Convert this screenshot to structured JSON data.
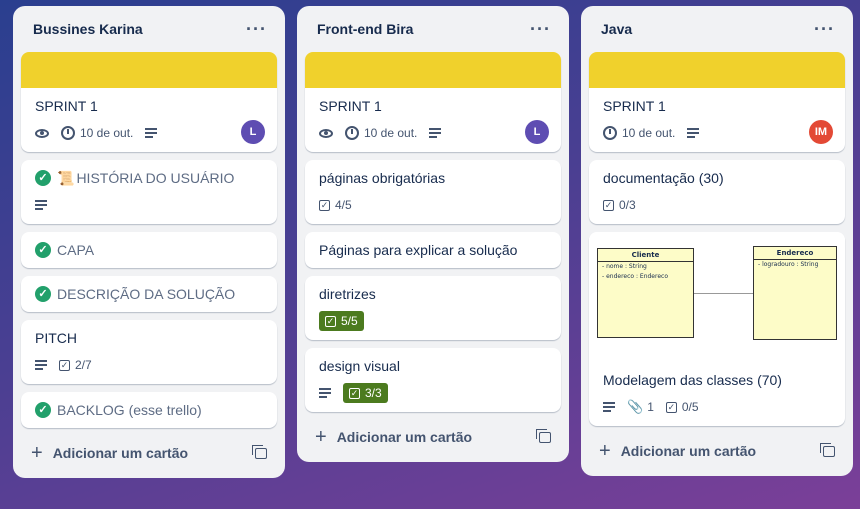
{
  "lists": [
    {
      "title": "Bussines Karina",
      "menu": "···",
      "add_card": "Adicionar um cartão",
      "cards": [
        {
          "title": "SPRINT 1",
          "date": "10 de out.",
          "avatar": "L",
          "avatar_color": "#5e4db2"
        },
        {
          "title": "HISTÓRIA DO USUÁRIO",
          "icon": "scroll-icon"
        },
        {
          "title": "CAPA"
        },
        {
          "title": "DESCRIÇÃO DA SOLUÇÃO"
        },
        {
          "title": "PITCH",
          "checklist": "2/7"
        },
        {
          "title": "BACKLOG (esse trello)"
        }
      ]
    },
    {
      "title": "Front-end Bira",
      "menu": "···",
      "add_card": "Adicionar um cartão",
      "cards": [
        {
          "title": "SPRINT 1",
          "date": "10 de out.",
          "avatar": "L",
          "avatar_color": "#5e4db2"
        },
        {
          "title": "páginas obrigatórias",
          "checklist": "4/5"
        },
        {
          "title": "Páginas para explicar a solução"
        },
        {
          "title": "diretrizes",
          "checklist": "5/5"
        },
        {
          "title": "design visual",
          "checklist": "3/3"
        }
      ]
    },
    {
      "title": "Java",
      "menu": "···",
      "add_card": "Adicionar um cartão",
      "cards": [
        {
          "title": "SPRINT 1",
          "date": "10 de out.",
          "avatar": "IM",
          "avatar_color": "#e34935"
        },
        {
          "title": "documentação (30)",
          "checklist": "0/3"
        },
        {
          "title": "Modelagem das classes (70)",
          "attachments": "1",
          "checklist": "0/5"
        }
      ]
    }
  ],
  "uml": {
    "class1": {
      "name": "Cliente",
      "attrs": [
        "- nome : String",
        "- endereco : Endereco"
      ]
    },
    "class2": {
      "name": "Endereco",
      "attrs": [
        "- logradouro : String"
      ]
    }
  },
  "colors": {
    "cover": "#f0d12c",
    "done_check": "#22a06b",
    "complete_badge": "#4c7b1f"
  }
}
